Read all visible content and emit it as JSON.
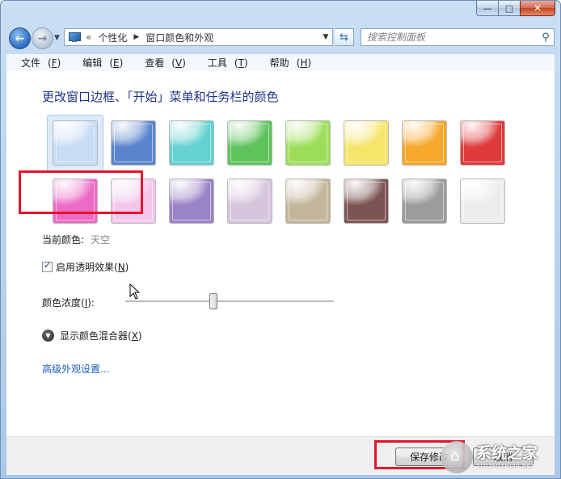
{
  "window": {
    "minimize_glyph": "—",
    "maximize_glyph": "□",
    "close_glyph": "✕"
  },
  "navigation": {
    "back_icon": "arrow-left-icon",
    "forward_icon": "arrow-right-icon",
    "address": {
      "chevron": "«",
      "breadcrumbs": [
        "个性化",
        "窗口颜色和外观"
      ],
      "separator": "▶"
    },
    "search_placeholder": "搜索控制面板"
  },
  "menu": {
    "items": [
      {
        "label": "文件",
        "key": "F"
      },
      {
        "label": "编辑",
        "key": "E"
      },
      {
        "label": "查看",
        "key": "V"
      },
      {
        "label": "工具",
        "key": "T"
      },
      {
        "label": "帮助",
        "key": "H"
      }
    ]
  },
  "page": {
    "heading": "更改窗口边框、「开始」菜单和任务栏的颜色",
    "current_color_label": "当前颜色:",
    "current_color_value": "天空",
    "transparency_label": "启用透明效果(",
    "transparency_key": "N",
    "transparency_checked": true,
    "intensity_label": "颜色浓度(",
    "intensity_key": "I",
    "intensity_value": 0.42,
    "mixer_label": "显示颜色混合器(",
    "mixer_key": "X",
    "advanced_link": "高级外观设置..."
  },
  "colors": [
    {
      "name": "sky",
      "hex": "#c7dcf5"
    },
    {
      "name": "twilight",
      "hex": "#5a84cc"
    },
    {
      "name": "sea",
      "hex": "#63d2d0"
    },
    {
      "name": "leaf",
      "hex": "#5fc35c"
    },
    {
      "name": "lime",
      "hex": "#9cde5a"
    },
    {
      "name": "sun",
      "hex": "#f5e56b"
    },
    {
      "name": "pumpkin",
      "hex": "#f7a72a"
    },
    {
      "name": "ruby",
      "hex": "#de3a3a"
    },
    {
      "name": "fuchsia",
      "hex": "#ee6bc5"
    },
    {
      "name": "blush",
      "hex": "#f3c6ec"
    },
    {
      "name": "violet",
      "hex": "#9a83c6"
    },
    {
      "name": "lavender",
      "hex": "#d6c5dc"
    },
    {
      "name": "taupe",
      "hex": "#c3b59a"
    },
    {
      "name": "chocolate",
      "hex": "#7c5553"
    },
    {
      "name": "slate",
      "hex": "#9c9c9c"
    },
    {
      "name": "frost",
      "hex": "#ececec"
    }
  ],
  "footer": {
    "save_label": "保存修改",
    "cancel_label": "取消"
  },
  "watermark": {
    "text": "系统之家",
    "sub": "XITONGZHIJIA.NET"
  }
}
